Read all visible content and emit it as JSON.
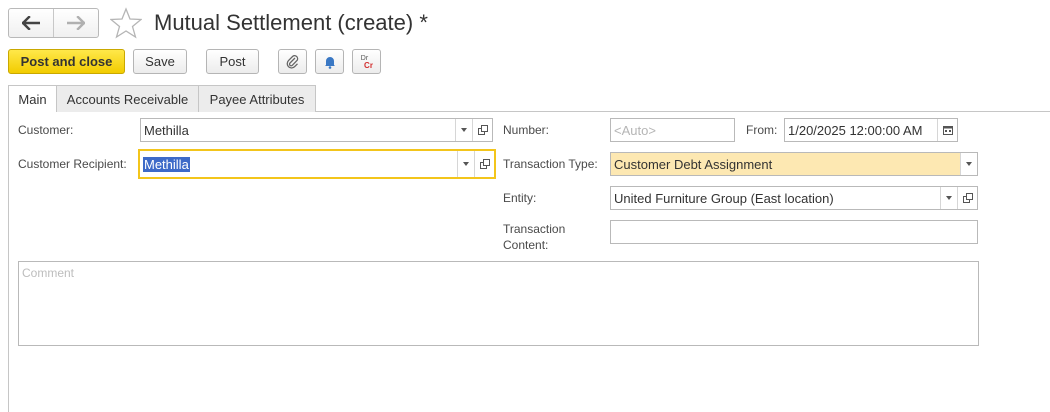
{
  "header": {
    "title": "Mutual Settlement (create) *"
  },
  "toolbar": {
    "post_and_close": "Post and close",
    "save": "Save",
    "post": "Post",
    "drcr_top": "Dr",
    "drcr_bottom": "Cr"
  },
  "tabs": [
    {
      "label": "Main",
      "active": true
    },
    {
      "label": "Accounts Receivable",
      "active": false
    },
    {
      "label": "Payee Attributes",
      "active": false
    }
  ],
  "form": {
    "customer_label": "Customer:",
    "customer_value": "Methilla",
    "recipient_label": "Customer Recipient:",
    "recipient_value": "Methilla",
    "number_label": "Number:",
    "number_placeholder": "<Auto>",
    "from_label": "From:",
    "from_value": "1/20/2025 12:00:00 AM",
    "transaction_type_label": "Transaction Type:",
    "transaction_type_value": "Customer Debt Assignment",
    "entity_label": "Entity:",
    "entity_value": "United Furniture Group (East location)",
    "content_label_line1": "Transaction",
    "content_label_line2": "Content:",
    "content_value": "",
    "comment_placeholder": "Comment"
  },
  "colors": {
    "primary_button": "#f7d51d",
    "focus_border": "#f3c51b",
    "highlight_field": "#fde8b2",
    "selection": "#3d6ac8"
  }
}
